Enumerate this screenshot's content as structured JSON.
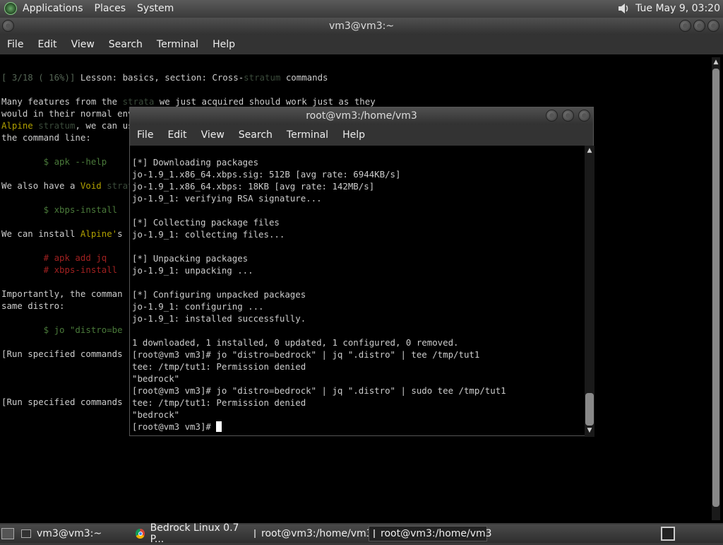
{
  "top_panel": {
    "menus": [
      "Applications",
      "Places",
      "System"
    ],
    "clock": "Tue May  9, 03:20"
  },
  "back_window": {
    "title": "vm3@vm3:~",
    "menus": [
      "File",
      "Edit",
      "View",
      "Search",
      "Terminal",
      "Help"
    ],
    "lines": [
      "[ 3/18 ( 16%)] Lesson: basics, section: Cross-stratum commands",
      "",
      "Many features from the strata we just acquired should work just as they",
      "would in their normal environments.  For example, since we now have an",
      "Alpine stratum, we can use Alpine's apk package manager directly on",
      "the command line:",
      "",
      "        $ apk --help",
      "",
      "We also have a Void stratum",
      "",
      "        $ xbps-install",
      "",
      "We can install Alpine's",
      "",
      "        # apk add jq",
      "        # xbps-install",
      "",
      "Importantly, the comman",
      "same distro:",
      "",
      "        $ jo \"distro=be",
      "",
      "[Run specified commands",
      "",
      "",
      "",
      "[Run specified commands"
    ]
  },
  "front_window": {
    "title": "root@vm3:/home/vm3",
    "menus": [
      "File",
      "Edit",
      "View",
      "Search",
      "Terminal",
      "Help"
    ],
    "lines": [
      "[*] Downloading packages",
      "jo-1.9_1.x86_64.xbps.sig: 512B [avg rate: 6944KB/s]",
      "jo-1.9_1.x86_64.xbps: 18KB [avg rate: 142MB/s]",
      "jo-1.9_1: verifying RSA signature...",
      "",
      "[*] Collecting package files",
      "jo-1.9_1: collecting files...",
      "",
      "[*] Unpacking packages",
      "jo-1.9_1: unpacking ...",
      "",
      "[*] Configuring unpacked packages",
      "jo-1.9_1: configuring ...",
      "jo-1.9_1: installed successfully.",
      "",
      "1 downloaded, 1 installed, 0 updated, 1 configured, 0 removed.",
      "[root@vm3 vm3]# jo \"distro=bedrock\" | jq \".distro\" | tee /tmp/tut1",
      "tee: /tmp/tut1: Permission denied",
      "\"bedrock\"",
      "[root@vm3 vm3]# jo \"distro=bedrock\" | jq \".distro\" | sudo tee /tmp/tut1",
      "tee: /tmp/tut1: Permission denied",
      "\"bedrock\""
    ],
    "prompt": "[root@vm3 vm3]# "
  },
  "taskbar": {
    "tasks": [
      "vm3@vm3:~",
      "Bedrock Linux 0.7 P...",
      "root@vm3:/home/vm3",
      "root@vm3:/home/vm3"
    ]
  }
}
